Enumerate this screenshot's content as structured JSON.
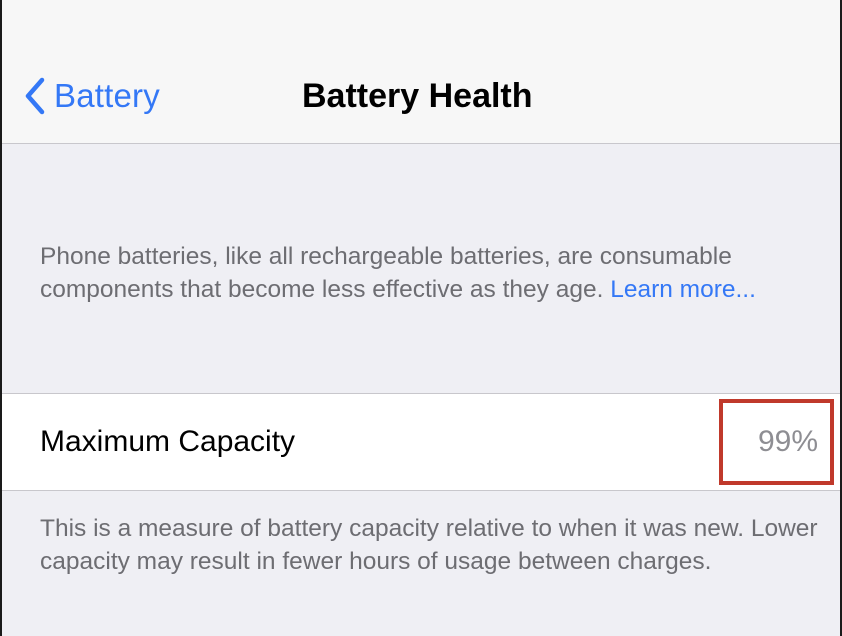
{
  "navbar": {
    "back_label": "Battery",
    "title": "Battery Health"
  },
  "intro": {
    "text": "Phone batteries, like all rechargeable batteries, are consumable components that become less effective as they age. ",
    "link": "Learn more..."
  },
  "capacity": {
    "label": "Maximum Capacity",
    "value": "99%"
  },
  "footer": {
    "text": "This is a measure of battery capacity relative to when it was new. Lower capacity may result in fewer hours of usage between charges."
  },
  "colors": {
    "accent": "#3478f6",
    "highlight": "#c0392b",
    "secondary_text": "#6d6d72"
  },
  "icons": {
    "back": "chevron-left-icon"
  }
}
